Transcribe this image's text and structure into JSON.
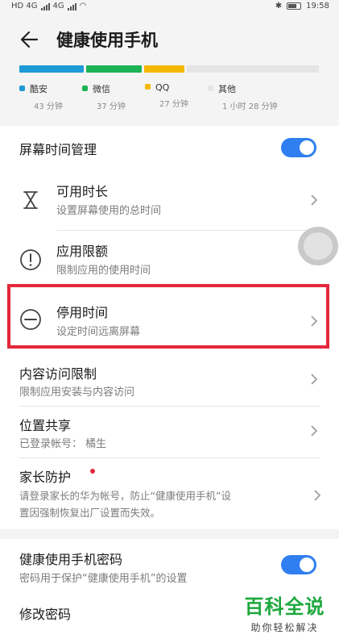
{
  "status_bar": {
    "carrier_left": "HD 4G",
    "carrier_right": "4G",
    "battery_pct": "",
    "time": "19:58"
  },
  "header": {
    "title": "健康使用手机"
  },
  "usage": {
    "segments": [
      {
        "name": "酷安",
        "time": "43 分钟",
        "color": "#1e9ad6",
        "minutes": 43
      },
      {
        "name": "微信",
        "time": "37 分钟",
        "color": "#1cb355",
        "minutes": 37
      },
      {
        "name": "QQ",
        "time": "27 分钟",
        "color": "#f5b800",
        "minutes": 27
      },
      {
        "name": "其他",
        "time": "1 小时 28 分钟",
        "color": "#e5e5e5",
        "minutes": 88
      }
    ]
  },
  "screen_time": {
    "label": "屏幕时间管理",
    "enabled": true,
    "items": [
      {
        "title": "可用时长",
        "subtitle": "设置屏幕使用的总时间",
        "icon": "hourglass-icon"
      },
      {
        "title": "应用限额",
        "subtitle": "限制应用的使用时间",
        "icon": "alert-circle-icon"
      },
      {
        "title": "停用时间",
        "subtitle": "设定时间远离屏幕",
        "icon": "minus-circle-icon"
      }
    ]
  },
  "content": {
    "items": [
      {
        "title": "内容访问限制",
        "subtitle": "限制应用安装与内容访问"
      },
      {
        "title": "位置共享",
        "subtitle": "已登录帐号： 橘生"
      },
      {
        "title": "家长防护",
        "subtitle_line1": "请登录家长的华为帐号，防止“健康使用手机”设",
        "subtitle_line2": "置因强制恢复出厂设置而失效。"
      }
    ]
  },
  "password": {
    "title": "健康使用手机密码",
    "subtitle": "密码用于保护“健康使用手机”的设置",
    "enabled": true,
    "change_label": "修改密码"
  },
  "watermark": {
    "main": "百科全说",
    "sub": "助你轻松解决"
  },
  "colors": {
    "accent": "#2f7ff0",
    "highlight": "#e4283c",
    "watermark_green": "#1da83d"
  }
}
